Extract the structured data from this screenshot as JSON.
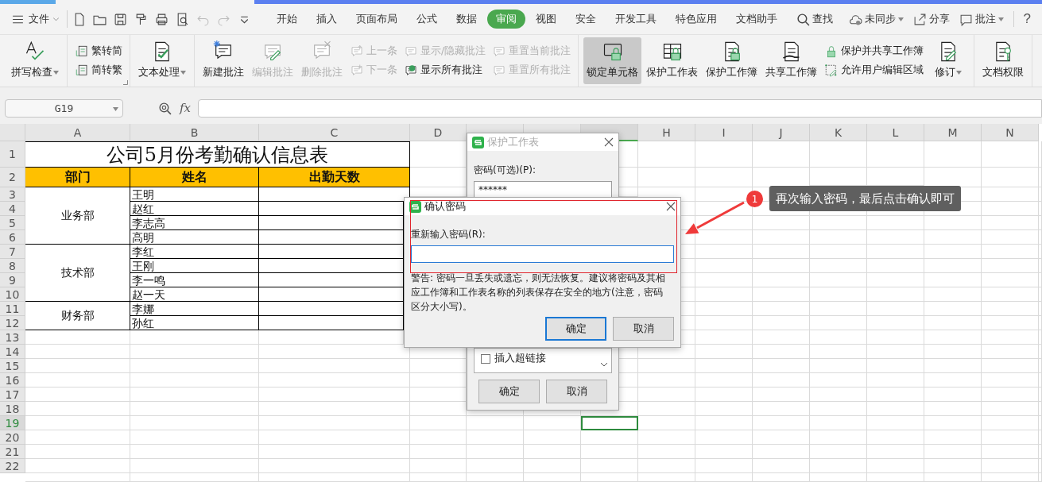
{
  "menu_bar": {
    "file_menu": "文件",
    "tabs": [
      {
        "label": "开始",
        "selected": false
      },
      {
        "label": "插入",
        "selected": false
      },
      {
        "label": "页面布局",
        "selected": false
      },
      {
        "label": "公式",
        "selected": false
      },
      {
        "label": "数据",
        "selected": false
      },
      {
        "label": "审阅",
        "selected": true
      },
      {
        "label": "视图",
        "selected": false
      },
      {
        "label": "安全",
        "selected": false
      },
      {
        "label": "开发工具",
        "selected": false
      },
      {
        "label": "特色应用",
        "selected": false
      },
      {
        "label": "文档助手",
        "selected": false
      }
    ],
    "search": "查找",
    "sync": "未同步",
    "share": "分享",
    "comments": "批注",
    "help": "?"
  },
  "ribbon": {
    "groups": [
      {
        "items": [
          {
            "kind": "large",
            "label": "拼写检查",
            "dropdown": true,
            "disabled": false,
            "on": false
          }
        ]
      },
      {
        "launcher": true,
        "items": [
          {
            "kind": "stack",
            "items": [
              {
                "label": "繁转简",
                "disabled": false
              },
              {
                "label": "简转繁",
                "disabled": false
              }
            ]
          }
        ]
      },
      {
        "items": [
          {
            "kind": "large",
            "label": "文本处理",
            "dropdown": true,
            "disabled": false,
            "on": false
          }
        ]
      },
      {
        "items": [
          {
            "kind": "large",
            "label": "新建批注",
            "dropdown": false,
            "disabled": false,
            "on": false
          },
          {
            "kind": "large",
            "label": "编辑批注",
            "dropdown": false,
            "disabled": true,
            "on": false
          },
          {
            "kind": "large",
            "label": "删除批注",
            "dropdown": false,
            "disabled": true,
            "on": false
          },
          {
            "kind": "stack",
            "items": [
              {
                "label": "上一条",
                "disabled": true
              },
              {
                "label": "下一条",
                "disabled": true
              }
            ]
          },
          {
            "kind": "stack",
            "items": [
              {
                "label": "显示/隐藏批注",
                "disabled": true
              },
              {
                "label": "显示所有批注",
                "disabled": false
              }
            ]
          },
          {
            "kind": "stack",
            "items": [
              {
                "label": "重置当前批注",
                "disabled": true
              },
              {
                "label": "重置所有批注",
                "disabled": true
              }
            ]
          }
        ]
      },
      {
        "items": [
          {
            "kind": "large",
            "label": "锁定单元格",
            "dropdown": false,
            "disabled": false,
            "on": true
          },
          {
            "kind": "large",
            "label": "保护工作表",
            "dropdown": false,
            "disabled": false,
            "on": false
          },
          {
            "kind": "large",
            "label": "保护工作簿",
            "dropdown": false,
            "disabled": false,
            "on": false
          },
          {
            "kind": "large",
            "label": "共享工作簿",
            "dropdown": false,
            "disabled": false,
            "on": false
          },
          {
            "kind": "stack",
            "items": [
              {
                "label": "保护并共享工作簿",
                "disabled": false
              },
              {
                "label": "允许用户编辑区域",
                "disabled": false
              }
            ]
          },
          {
            "kind": "large",
            "label": "修订",
            "dropdown": true,
            "disabled": false,
            "on": false
          }
        ]
      },
      {
        "items": [
          {
            "kind": "large",
            "label": "文档权限",
            "dropdown": false,
            "disabled": false,
            "on": false
          }
        ]
      }
    ]
  },
  "formula_bar": {
    "name_box": "G19",
    "fx_label": "fx"
  },
  "sheet": {
    "columns": [
      {
        "label": "A",
        "selected": false
      },
      {
        "label": "B",
        "selected": false
      },
      {
        "label": "C",
        "selected": false
      },
      {
        "label": "D",
        "selected": false
      },
      {
        "selected": false
      },
      {
        "selected": false
      },
      {
        "selected": true
      },
      {
        "label": "H",
        "selected": false
      },
      {
        "label": "I",
        "selected": false
      },
      {
        "label": "J",
        "selected": false
      },
      {
        "label": "K",
        "selected": false
      },
      {
        "label": "L",
        "selected": false
      },
      {
        "label": "M",
        "selected": false
      },
      {
        "label": "N",
        "selected": false
      }
    ],
    "rows": [
      {
        "label": "1",
        "selected": false
      },
      {
        "label": "2",
        "selected": false
      },
      {
        "label": "3",
        "selected": false
      },
      {
        "label": "4",
        "selected": false
      },
      {
        "label": "5",
        "selected": false
      },
      {
        "label": "6",
        "selected": false
      },
      {
        "label": "7",
        "selected": false
      },
      {
        "label": "8",
        "selected": false
      },
      {
        "label": "9",
        "selected": false
      },
      {
        "label": "10",
        "selected": false
      },
      {
        "label": "11",
        "selected": false
      },
      {
        "label": "12",
        "selected": false
      },
      {
        "label": "13",
        "selected": false
      },
      {
        "label": "14",
        "selected": false
      },
      {
        "label": "15",
        "selected": false
      },
      {
        "label": "16",
        "selected": false
      },
      {
        "label": "17",
        "selected": false
      },
      {
        "label": "18",
        "selected": false
      },
      {
        "label": "19",
        "selected": true
      },
      {
        "label": "20",
        "selected": false
      },
      {
        "label": "21",
        "selected": false
      },
      {
        "label": "22",
        "selected": false
      }
    ],
    "table": {
      "title": "公司5月份考勤确认信息表",
      "headers": [
        "部门",
        "姓名",
        "出勤天数"
      ],
      "groups": [
        {
          "department": "业务部",
          "names": [
            "王明",
            "赵红",
            "李志高",
            "高明"
          ]
        },
        {
          "department": "技术部",
          "names": [
            "李红",
            "王刚",
            "李一鸣",
            "赵一天"
          ]
        },
        {
          "department": "财务部",
          "names": [
            "李娜",
            "孙红"
          ]
        }
      ]
    }
  },
  "protect_dialog": {
    "title": "保护工作表",
    "active": false,
    "password_label": "密码(可选)(P):",
    "password_value": "******",
    "permissions": [
      {
        "label": "插入超链接",
        "checked": false
      }
    ],
    "buttons": [
      {
        "label": "确定",
        "default": false
      },
      {
        "label": "取消",
        "default": false
      }
    ]
  },
  "confirm_dialog": {
    "title": "确认密码",
    "active": true,
    "label": "重新输入密码(R):",
    "warning": "警告: 密码一旦丢失或遗忘，则无法恢复。建议将密码及其相应工作簿和工作表名称的列表保存在安全的地方(注意，密码区分大小写)。",
    "buttons": [
      {
        "label": "确定",
        "default": true
      },
      {
        "label": "取消",
        "default": false
      }
    ]
  },
  "annotation": {
    "step": "1",
    "text": "再次输入密码，最后点击确认即可"
  }
}
